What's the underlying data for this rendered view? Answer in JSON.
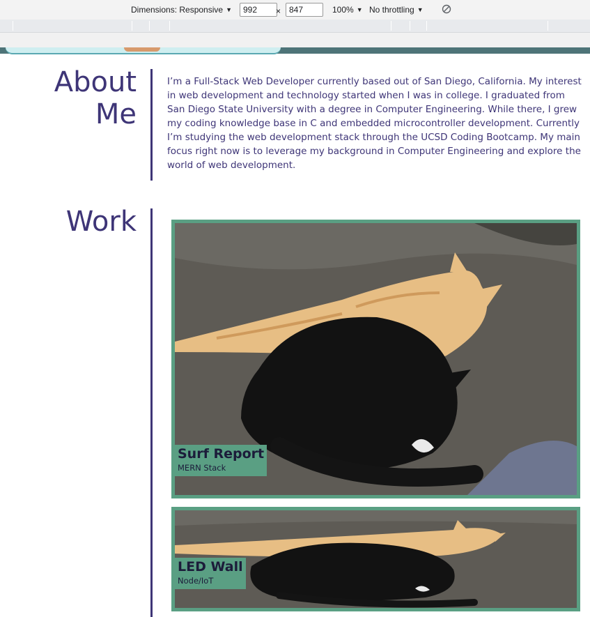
{
  "devtools": {
    "dimensions_label": "Dimensions: Responsive",
    "width_value": "992",
    "times": "×",
    "height_value": "847",
    "zoom": "100%",
    "throttling": "No throttling",
    "rotate_icon": "rotate-icon"
  },
  "about": {
    "heading": "About Me",
    "text": "I’m a Full-Stack Web Developer currently based out of San Diego, California. My interest in web development and technology started when I was in college. I graduated from San Diego State University with a degree in Computer Engineering. While there, I grew my coding knowledge base in C and embedded microcontroller development. Currently I’m studying the web development stack through the UCSD Coding Bootcamp. My main focus right now is to leverage my background in Computer Engineering and explore the world of web development."
  },
  "work": {
    "heading": "Work",
    "projects": [
      {
        "title": "Surf Report",
        "subtitle": "MERN Stack"
      },
      {
        "title": "LED Wall",
        "subtitle": "Node/IoT"
      }
    ]
  },
  "colors": {
    "heading": "#3e3577",
    "card_border": "#5a9f83",
    "header_bar": "#4e7478"
  }
}
